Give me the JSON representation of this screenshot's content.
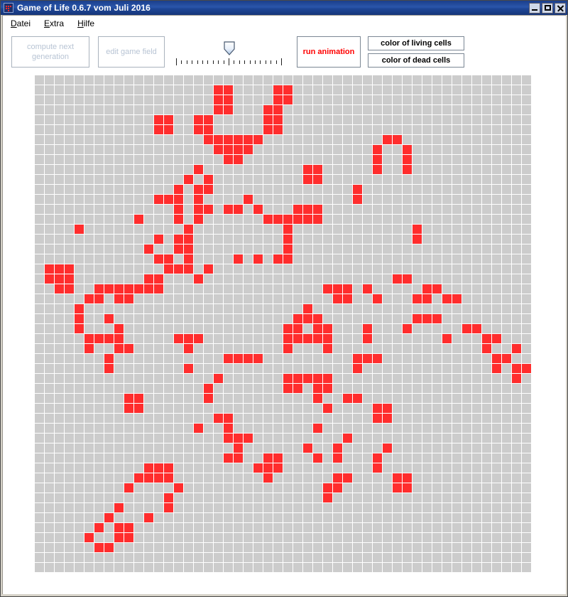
{
  "window": {
    "title": "Game of Life 0.6.7 vom Juli 2016",
    "icon": "app-grid-icon",
    "controls": {
      "minimize": "minimize-icon",
      "maximize": "maximize-icon",
      "close": "close-icon"
    }
  },
  "menu": {
    "items": [
      {
        "label": "Datei",
        "mnemonic": "D"
      },
      {
        "label": "Extra",
        "mnemonic": "E"
      },
      {
        "label": "Hilfe",
        "mnemonic": "H"
      }
    ]
  },
  "toolbar": {
    "compute_next_generation": "compute next generation",
    "compute_next_generation_enabled": false,
    "edit_game_field": "edit game field",
    "edit_game_field_enabled": false,
    "run_animation": "run animation",
    "run_animation_enabled": true,
    "color_living_cells": "color of living cells",
    "color_dead_cells": "color of dead cells",
    "speed_slider": {
      "name": "speed-slider",
      "ticks": 21,
      "value_index": 10
    }
  },
  "colors": {
    "living_cell": "#ff2d2d",
    "dead_cell": "#cccccc",
    "grid_background": "#ffffff",
    "title_bar": "#1f4798",
    "run_label": "#ff0000",
    "window_frame": "#d6d2c8"
  },
  "grid": {
    "columns": 50,
    "rows": 50,
    "cell_size_px": 14,
    "alive_cells": [
      [
        1,
        18
      ],
      [
        1,
        19
      ],
      [
        1,
        24
      ],
      [
        1,
        25
      ],
      [
        2,
        18
      ],
      [
        2,
        19
      ],
      [
        2,
        24
      ],
      [
        2,
        25
      ],
      [
        3,
        18
      ],
      [
        3,
        19
      ],
      [
        3,
        23
      ],
      [
        3,
        24
      ],
      [
        4,
        12
      ],
      [
        4,
        13
      ],
      [
        4,
        16
      ],
      [
        4,
        17
      ],
      [
        4,
        23
      ],
      [
        4,
        24
      ],
      [
        5,
        12
      ],
      [
        5,
        13
      ],
      [
        5,
        16
      ],
      [
        5,
        17
      ],
      [
        5,
        23
      ],
      [
        5,
        24
      ],
      [
        6,
        17
      ],
      [
        6,
        18
      ],
      [
        6,
        19
      ],
      [
        6,
        20
      ],
      [
        6,
        21
      ],
      [
        6,
        22
      ],
      [
        6,
        35
      ],
      [
        6,
        36
      ],
      [
        7,
        18
      ],
      [
        7,
        19
      ],
      [
        7,
        20
      ],
      [
        7,
        21
      ],
      [
        7,
        34
      ],
      [
        7,
        37
      ],
      [
        8,
        19
      ],
      [
        8,
        20
      ],
      [
        8,
        34
      ],
      [
        8,
        37
      ],
      [
        9,
        16
      ],
      [
        9,
        27
      ],
      [
        9,
        28
      ],
      [
        9,
        34
      ],
      [
        9,
        37
      ],
      [
        10,
        15
      ],
      [
        10,
        17
      ],
      [
        10,
        27
      ],
      [
        10,
        28
      ],
      [
        11,
        14
      ],
      [
        11,
        16
      ],
      [
        11,
        17
      ],
      [
        11,
        32
      ],
      [
        12,
        12
      ],
      [
        12,
        13
      ],
      [
        12,
        14
      ],
      [
        12,
        16
      ],
      [
        12,
        21
      ],
      [
        12,
        32
      ],
      [
        13,
        14
      ],
      [
        13,
        16
      ],
      [
        13,
        17
      ],
      [
        13,
        19
      ],
      [
        13,
        20
      ],
      [
        13,
        22
      ],
      [
        13,
        26
      ],
      [
        13,
        27
      ],
      [
        13,
        28
      ],
      [
        14,
        10
      ],
      [
        14,
        14
      ],
      [
        14,
        16
      ],
      [
        14,
        23
      ],
      [
        14,
        24
      ],
      [
        14,
        25
      ],
      [
        14,
        26
      ],
      [
        14,
        27
      ],
      [
        14,
        28
      ],
      [
        15,
        4
      ],
      [
        15,
        15
      ],
      [
        15,
        25
      ],
      [
        15,
        38
      ],
      [
        16,
        12
      ],
      [
        16,
        14
      ],
      [
        16,
        15
      ],
      [
        16,
        25
      ],
      [
        16,
        38
      ],
      [
        17,
        11
      ],
      [
        17,
        14
      ],
      [
        17,
        15
      ],
      [
        17,
        25
      ],
      [
        18,
        12
      ],
      [
        18,
        13
      ],
      [
        18,
        15
      ],
      [
        18,
        20
      ],
      [
        18,
        22
      ],
      [
        18,
        24
      ],
      [
        18,
        25
      ],
      [
        19,
        1
      ],
      [
        19,
        2
      ],
      [
        19,
        3
      ],
      [
        19,
        13
      ],
      [
        19,
        14
      ],
      [
        19,
        15
      ],
      [
        19,
        17
      ],
      [
        20,
        1
      ],
      [
        20,
        2
      ],
      [
        20,
        3
      ],
      [
        20,
        11
      ],
      [
        20,
        12
      ],
      [
        20,
        16
      ],
      [
        20,
        36
      ],
      [
        20,
        37
      ],
      [
        21,
        2
      ],
      [
        21,
        3
      ],
      [
        21,
        6
      ],
      [
        21,
        7
      ],
      [
        21,
        8
      ],
      [
        21,
        9
      ],
      [
        21,
        10
      ],
      [
        21,
        11
      ],
      [
        21,
        12
      ],
      [
        21,
        29
      ],
      [
        21,
        30
      ],
      [
        21,
        31
      ],
      [
        21,
        33
      ],
      [
        21,
        39
      ],
      [
        21,
        40
      ],
      [
        22,
        5
      ],
      [
        22,
        6
      ],
      [
        22,
        8
      ],
      [
        22,
        9
      ],
      [
        22,
        30
      ],
      [
        22,
        31
      ],
      [
        22,
        34
      ],
      [
        22,
        38
      ],
      [
        22,
        39
      ],
      [
        22,
        41
      ],
      [
        22,
        42
      ],
      [
        23,
        4
      ],
      [
        23,
        27
      ],
      [
        24,
        4
      ],
      [
        24,
        7
      ],
      [
        24,
        26
      ],
      [
        24,
        27
      ],
      [
        24,
        28
      ],
      [
        24,
        38
      ],
      [
        24,
        39
      ],
      [
        24,
        40
      ],
      [
        25,
        4
      ],
      [
        25,
        8
      ],
      [
        25,
        25
      ],
      [
        25,
        26
      ],
      [
        25,
        28
      ],
      [
        25,
        29
      ],
      [
        25,
        33
      ],
      [
        25,
        37
      ],
      [
        25,
        43
      ],
      [
        25,
        44
      ],
      [
        26,
        5
      ],
      [
        26,
        6
      ],
      [
        26,
        7
      ],
      [
        26,
        8
      ],
      [
        26,
        14
      ],
      [
        26,
        15
      ],
      [
        26,
        16
      ],
      [
        26,
        25
      ],
      [
        26,
        26
      ],
      [
        26,
        27
      ],
      [
        26,
        28
      ],
      [
        26,
        29
      ],
      [
        26,
        33
      ],
      [
        26,
        41
      ],
      [
        26,
        45
      ],
      [
        26,
        46
      ],
      [
        27,
        5
      ],
      [
        27,
        8
      ],
      [
        27,
        9
      ],
      [
        27,
        15
      ],
      [
        27,
        25
      ],
      [
        27,
        29
      ],
      [
        27,
        45
      ],
      [
        27,
        48
      ],
      [
        28,
        7
      ],
      [
        28,
        19
      ],
      [
        28,
        20
      ],
      [
        28,
        21
      ],
      [
        28,
        22
      ],
      [
        28,
        32
      ],
      [
        28,
        33
      ],
      [
        28,
        34
      ],
      [
        28,
        46
      ],
      [
        28,
        47
      ],
      [
        29,
        7
      ],
      [
        29,
        15
      ],
      [
        29,
        32
      ],
      [
        29,
        46
      ],
      [
        29,
        48
      ],
      [
        29,
        49
      ],
      [
        30,
        18
      ],
      [
        30,
        25
      ],
      [
        30,
        26
      ],
      [
        30,
        27
      ],
      [
        30,
        28
      ],
      [
        30,
        29
      ],
      [
        30,
        48
      ],
      [
        31,
        17
      ],
      [
        31,
        25
      ],
      [
        31,
        26
      ],
      [
        31,
        28
      ],
      [
        31,
        29
      ],
      [
        32,
        9
      ],
      [
        32,
        10
      ],
      [
        32,
        17
      ],
      [
        32,
        28
      ],
      [
        32,
        31
      ],
      [
        32,
        32
      ],
      [
        33,
        9
      ],
      [
        33,
        10
      ],
      [
        33,
        29
      ],
      [
        33,
        34
      ],
      [
        33,
        35
      ],
      [
        34,
        18
      ],
      [
        34,
        19
      ],
      [
        34,
        34
      ],
      [
        34,
        35
      ],
      [
        35,
        16
      ],
      [
        35,
        19
      ],
      [
        35,
        28
      ],
      [
        36,
        19
      ],
      [
        36,
        20
      ],
      [
        36,
        21
      ],
      [
        36,
        31
      ],
      [
        37,
        20
      ],
      [
        37,
        27
      ],
      [
        37,
        30
      ],
      [
        37,
        35
      ],
      [
        38,
        19
      ],
      [
        38,
        20
      ],
      [
        38,
        23
      ],
      [
        38,
        24
      ],
      [
        38,
        28
      ],
      [
        38,
        30
      ],
      [
        38,
        34
      ],
      [
        39,
        11
      ],
      [
        39,
        12
      ],
      [
        39,
        13
      ],
      [
        39,
        22
      ],
      [
        39,
        23
      ],
      [
        39,
        24
      ],
      [
        39,
        34
      ],
      [
        40,
        10
      ],
      [
        40,
        11
      ],
      [
        40,
        12
      ],
      [
        40,
        13
      ],
      [
        40,
        23
      ],
      [
        40,
        30
      ],
      [
        40,
        31
      ],
      [
        40,
        36
      ],
      [
        40,
        37
      ],
      [
        41,
        9
      ],
      [
        41,
        14
      ],
      [
        41,
        29
      ],
      [
        41,
        30
      ],
      [
        41,
        36
      ],
      [
        41,
        37
      ],
      [
        42,
        13
      ],
      [
        42,
        29
      ],
      [
        43,
        8
      ],
      [
        43,
        13
      ],
      [
        44,
        7
      ],
      [
        44,
        11
      ],
      [
        45,
        6
      ],
      [
        45,
        8
      ],
      [
        45,
        9
      ],
      [
        46,
        5
      ],
      [
        46,
        8
      ],
      [
        46,
        9
      ],
      [
        47,
        6
      ],
      [
        47,
        7
      ]
    ]
  }
}
